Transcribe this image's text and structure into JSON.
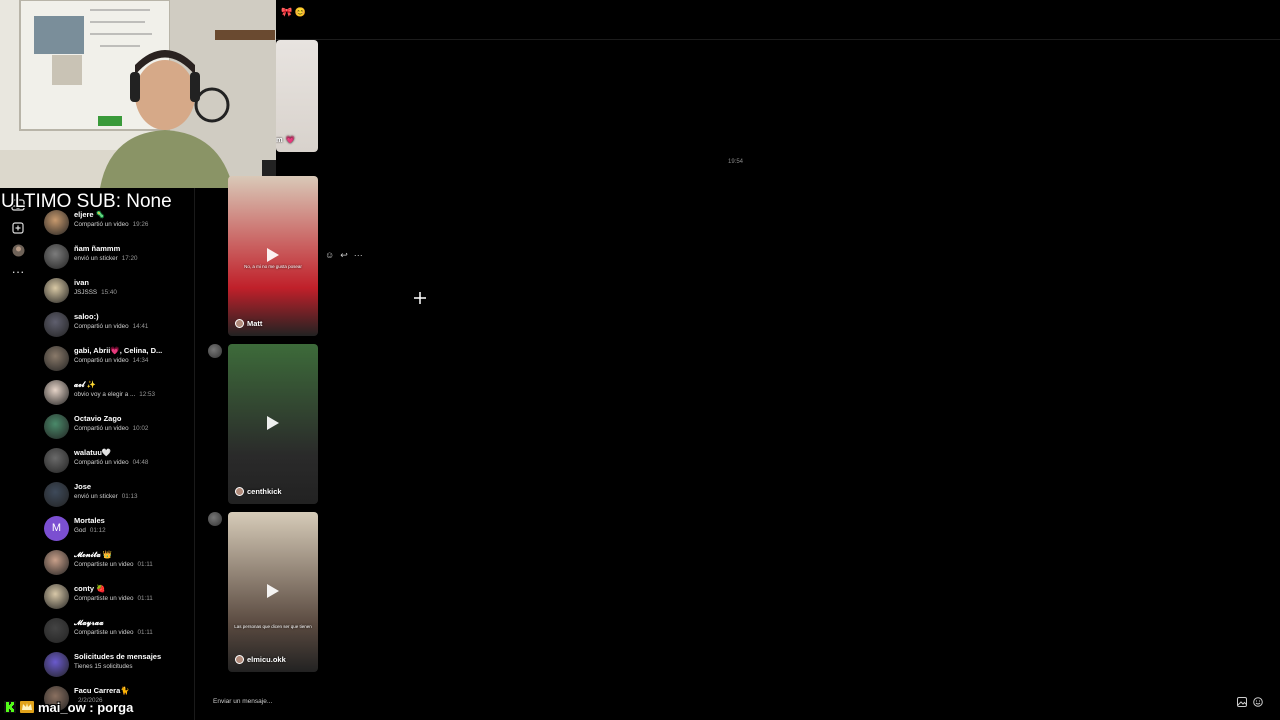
{
  "stream_overlay": {
    "title": "ULTIMO SUB: None",
    "chat_message": "mai_ow : porga"
  },
  "topbar": {
    "emojis": "🎀 😊"
  },
  "sidebar_rail": {
    "icons": [
      "inbox-icon",
      "new-message-icon",
      "profile-icon",
      "more-icon"
    ],
    "more_label": "···"
  },
  "conversations": [
    {
      "name": "eljere 🦠",
      "preview": "Compartió un video",
      "time": "19:26",
      "avatar_color": "#c89a6e"
    },
    {
      "name": "ñam ñammm",
      "preview": "envió un sticker",
      "time": "17:20",
      "avatar_color": "#7c7c7c"
    },
    {
      "name": "ivan",
      "preview": "JSJSSS",
      "time": "15:40",
      "avatar_color": "#d9c9a5"
    },
    {
      "name": "saloo:)",
      "preview": "Compartió un video",
      "time": "14:41",
      "avatar_color": "#5f5f6e"
    },
    {
      "name": "gabi, Abrii💗, Celina, D...",
      "preview": "Compartió un video",
      "time": "14:34",
      "avatar_color": "#8a7a6a"
    },
    {
      "name": "𝓪𝓮𝓵 ✨",
      "preview": "obvio voy a elegir a ...",
      "time": "12:53",
      "avatar_color": "#e6d4c8"
    },
    {
      "name": "Octavio Zago",
      "preview": "Compartió un video",
      "time": "10:02",
      "avatar_color": "#4a8a6a"
    },
    {
      "name": "walatuu🤍",
      "preview": "Compartió un video",
      "time": "04:48",
      "avatar_color": "#6a6a6a"
    },
    {
      "name": "Jose",
      "preview": "envió un sticker",
      "time": "01:13",
      "avatar_color": "#3e4a5a"
    },
    {
      "name": "Mortales",
      "preview": "God",
      "time": "01:12",
      "avatar_color": "#7b4fd1",
      "initial": "M"
    },
    {
      "name": "𝓜𝓸𝓷𝓲𝓽𝓪 👑",
      "preview": "Compartiste un video",
      "time": "01:11",
      "avatar_color": "#c9a08a"
    },
    {
      "name": "conty 🍓",
      "preview": "Compartiste un video",
      "time": "01:11",
      "avatar_color": "#d8c8a8"
    },
    {
      "name": "𝓜𝓪𝔂𝓻𝓪𝓪",
      "preview": "Compartiste un video",
      "time": "01:11",
      "avatar_color": "#444444"
    },
    {
      "name": "Solicitudes de mensajes",
      "preview": "Tienes 15 solicitudes",
      "time": "",
      "avatar_color": "#6a5acd"
    },
    {
      "name": "Facu Carrera🐈",
      "preview": "",
      "time": "2/2/2026",
      "avatar_color": "#8a7060"
    }
  ],
  "chat": {
    "timestamp": "19:54",
    "videos": [
      {
        "author": "Matt",
        "caption": "No, a mi no me gusta posear",
        "colors": [
          "#d9c9b8",
          "#c0202a"
        ]
      },
      {
        "author": "centhkick",
        "caption": "",
        "colors": [
          "#3d6b3a",
          "#2a2a2a"
        ]
      },
      {
        "author": "elmicu.okk",
        "caption": "Las personas que dicen ser que tienen",
        "colors": [
          "#d6cbb8",
          "#5a4a40"
        ]
      }
    ],
    "partial_video_author": "m",
    "actions": {
      "react": "☺",
      "reply": "↩",
      "more": "···"
    }
  },
  "composer": {
    "placeholder": "Enviar un mensaje...",
    "icons": [
      "image-icon",
      "emoji-icon"
    ]
  }
}
